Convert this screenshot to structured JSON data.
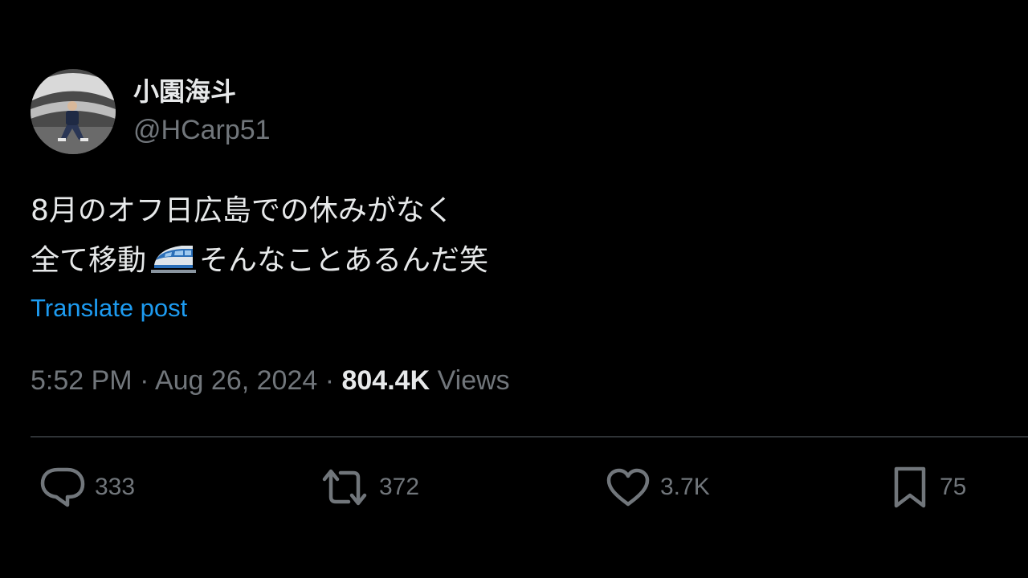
{
  "user": {
    "display_name": "小園海斗",
    "handle": "@HCarp51"
  },
  "tweet": {
    "line1": "8月のオフ日広島での休みがなく",
    "line2_before_emoji": "全て移動",
    "emoji": "bullet-train-icon",
    "line2_after_emoji": "そんなことあるんだ笑"
  },
  "translate_label": "Translate post",
  "meta": {
    "time": "5:52 PM",
    "separator1": " · ",
    "date": "Aug 26, 2024",
    "separator2": " · ",
    "views_count": "804.4K",
    "views_label": " Views"
  },
  "actions": {
    "replies": "333",
    "reposts": "372",
    "likes": "3.7K",
    "bookmarks": "75"
  },
  "colors": {
    "background": "#000000",
    "text_primary": "#e7e9ea",
    "text_secondary": "#71767b",
    "link": "#1d9bf0",
    "divider": "#2f3336"
  }
}
